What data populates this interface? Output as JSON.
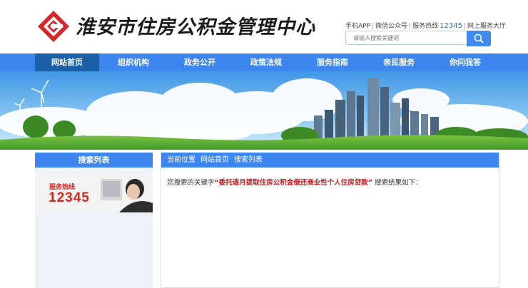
{
  "header": {
    "site_title": "淮安市住房公积金管理中心",
    "links": {
      "app": "手机APP",
      "wechat": "微信公众号",
      "hotline_label": "服务热线",
      "hotline_number": "12345",
      "online_hall": "网上服务大厅"
    },
    "search": {
      "placeholder": "请输入搜索关键词"
    },
    "colors": {
      "logo": "#d7262b",
      "accent": "#3d86ef"
    }
  },
  "nav": {
    "items": [
      {
        "label": "网站首页",
        "active": true
      },
      {
        "label": "组织机构"
      },
      {
        "label": "政务公开"
      },
      {
        "label": "政策法规"
      },
      {
        "label": "服务指南"
      },
      {
        "label": "亲民服务"
      },
      {
        "label": "你问我答"
      }
    ]
  },
  "sidebar": {
    "title": "搜索列表",
    "hotline_card": {
      "label": "服务热线",
      "number": "12345"
    }
  },
  "content": {
    "breadcrumb": [
      "当前位置",
      "网站首页",
      "搜索列表"
    ],
    "result_prefix": "您搜索的关键字",
    "keyword": "“委托逐月提取住房公积金偿还商业性个人住房贷款”",
    "result_suffix": "搜索结果如下："
  }
}
